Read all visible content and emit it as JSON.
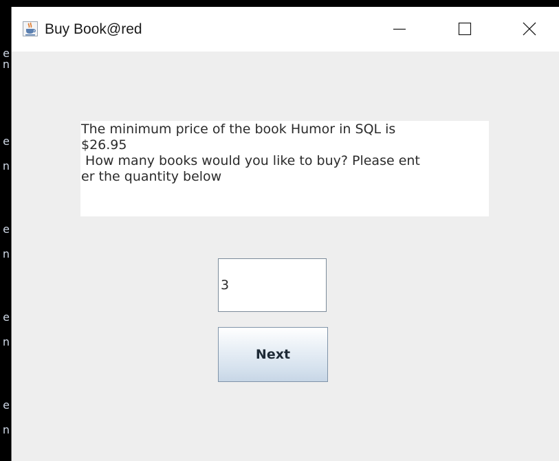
{
  "window": {
    "title": "Buy Book@red",
    "icon": "java-cup-icon",
    "controls": {
      "minimize": "minimize-icon",
      "maximize": "maximize-icon",
      "close": "close-icon"
    }
  },
  "background_edge": {
    "glyphs": [
      "e",
      "n",
      "e",
      "n",
      "e",
      "n",
      "e",
      "n",
      "e",
      "n"
    ]
  },
  "dialog": {
    "message": "The minimum price of the book Humor in SQL is\n$26.95\n How many books would you like to buy? Please ent\ner the quantity below",
    "quantity_value": "3",
    "next_label": "Next"
  },
  "colors": {
    "window_background": "#eeeeee",
    "titlebar_background": "#ffffff",
    "message_background": "#ffffff",
    "button_top": "#ffffff",
    "button_bottom": "#c7d6e6",
    "button_border": "#7f93a8"
  }
}
